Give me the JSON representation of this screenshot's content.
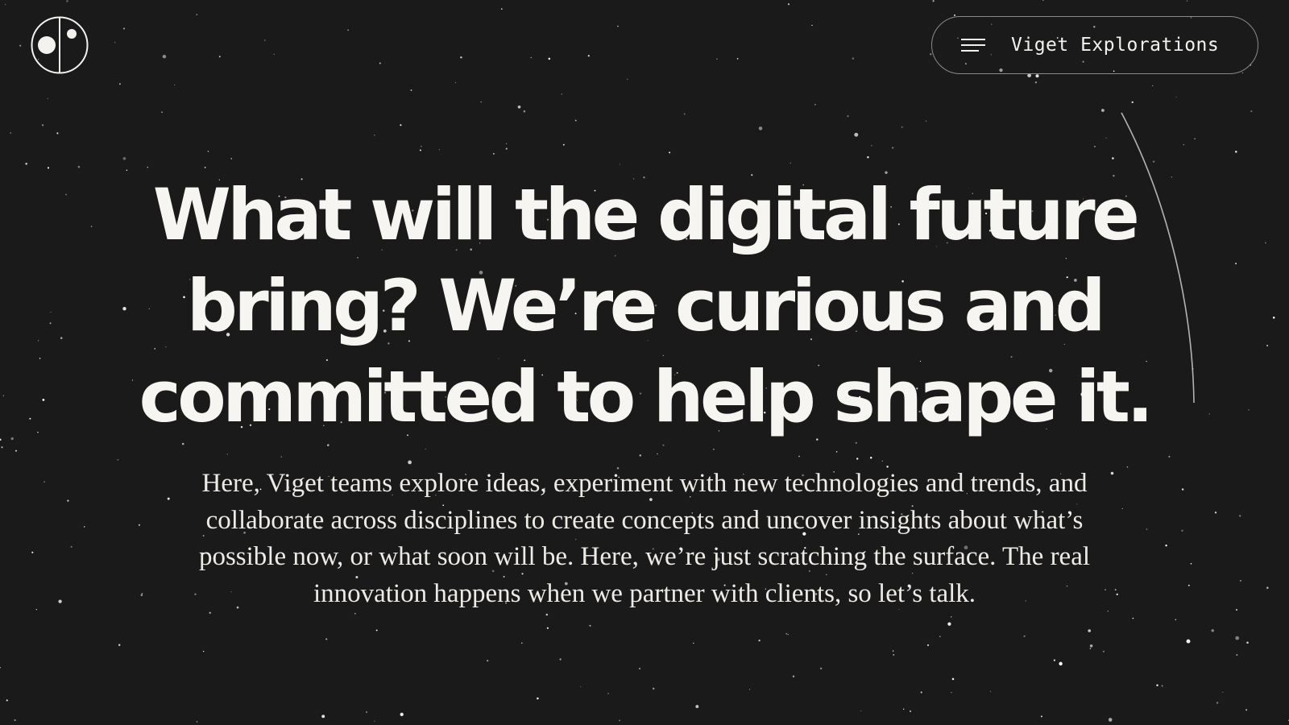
{
  "site": {
    "logo_icon": "viget-explorations-logo-icon"
  },
  "nav": {
    "menu_icon": "hamburger-menu-icon",
    "label": "Viget Explorations"
  },
  "hero": {
    "headline": "What will the digital future bring? We’re curious and committed to help shape it.",
    "body": "Here, Viget teams explore ideas, experiment with new technologies and trends, and collaborate across disciplines to create concepts and uncover insights about what’s possible now, or what soon will be. Here, we’re just scratching the surface. The real innovation happens when we partner with clients, so let’s talk."
  },
  "colors": {
    "background": "#1a1a1a",
    "text": "#f4f2ee",
    "pill_border": "#8a8a88"
  }
}
